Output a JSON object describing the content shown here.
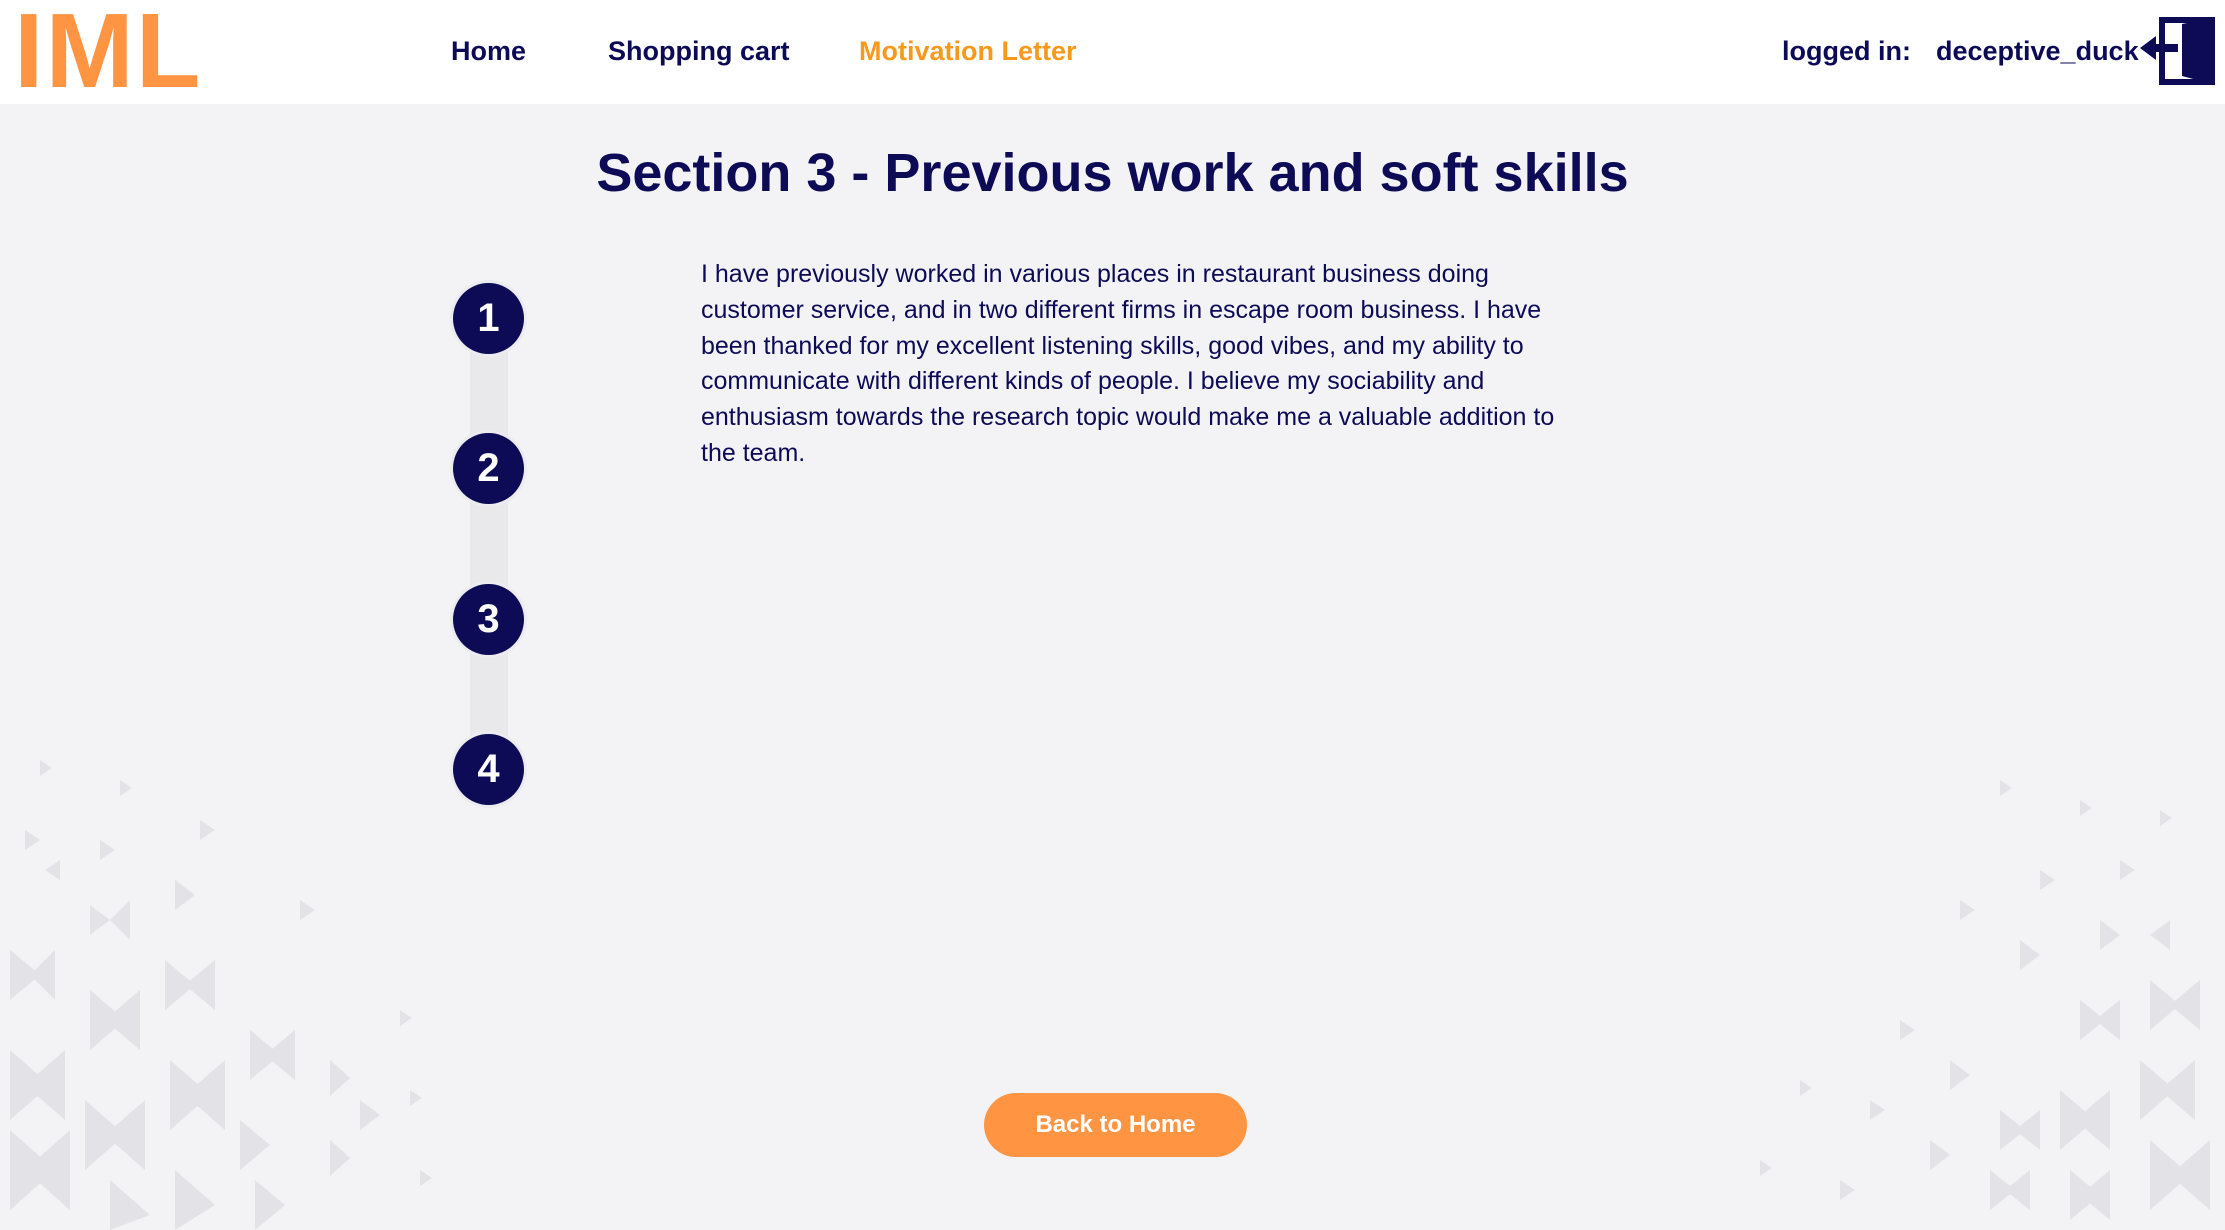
{
  "header": {
    "logo": "IML",
    "nav": [
      {
        "label": "Home",
        "active": false
      },
      {
        "label": "Shopping cart",
        "active": false
      },
      {
        "label": "Motivation Letter",
        "active": true
      }
    ],
    "logged_in_label": "logged in:",
    "username": "deceptive_duck",
    "logout_icon": "logout-door-icon"
  },
  "main": {
    "title": "Section 3 - Previous work and soft skills",
    "steps": [
      "1",
      "2",
      "3",
      "4"
    ],
    "text": "I have previously worked in various places in restaurant business doing customer service, and in two different firms in escape room business. I have been thanked for my excellent listening skills, good vibes, and my ability to communicate with different kinds of people. I believe my sociability and enthusiasm towards the research topic would make me a valuable addition to the team.",
    "back_button": "Back to Home"
  },
  "colors": {
    "primary": "#0d0a56",
    "accent": "#ff9442",
    "active_link": "#f7991c",
    "background": "#f3f3f5"
  }
}
